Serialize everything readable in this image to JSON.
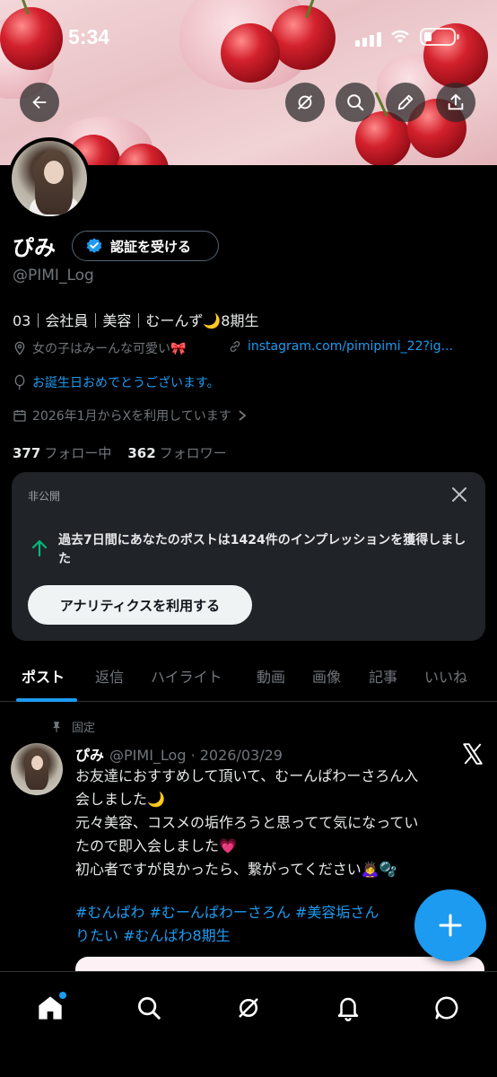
{
  "status_bar": {
    "time": "5:34"
  },
  "profile": {
    "name": "ぴみ",
    "verify_label": "認証を受ける",
    "handle": "@PIMI_Log",
    "bio": "03｜会社員｜美容｜むーんず🌙8期生",
    "location": "女の子はみーんな可愛い🎀",
    "link": "instagram.com/pimipimi_22?ig...",
    "birthday": "お誕生日おめでとうございます。",
    "joined": "2026年1月からXを利用しています",
    "following_count": "377",
    "following_label": "フォロー中",
    "followers_count": "362",
    "followers_label": "フォロワー"
  },
  "private_card": {
    "label": "非公開",
    "message": "過去7日間にあなたのポストは1424件のインプレッションを獲得しました",
    "button": "アナリティクスを利用する"
  },
  "tabs": [
    "ポスト",
    "返信",
    "ハイライト",
    "動画",
    "画像",
    "記事",
    "いいね"
  ],
  "post": {
    "pinned_label": "固定",
    "author": "ぴみ",
    "meta": "@PIMI_Log · 2026/03/29",
    "text_lines": [
      "お友達におすすめして頂いて、むーんぱわーさろん入",
      "会しました🌙",
      "元々美容、コスメの垢作ろうと思ってて気になってい",
      "たので即入会しました💗",
      "初心者ですが良かったら、繋がってください🙇‍♀️🫧"
    ],
    "tags_line1": "#むんぱわ  #むーんぱわーさろん #美容垢さん",
    "tags_line2": "りたい  #むんぱわ8期生"
  },
  "colors": {
    "accent": "#1d9bf0",
    "background": "#000000",
    "card": "#202327",
    "muted": "#71767b"
  },
  "icons": {
    "header": [
      "back-arrow-icon",
      "grok-icon",
      "search-icon",
      "edit-pencil-icon",
      "share-icon"
    ],
    "bottom_nav": [
      "home-icon",
      "search-icon",
      "grok-icon",
      "bell-icon",
      "messages-icon"
    ]
  }
}
